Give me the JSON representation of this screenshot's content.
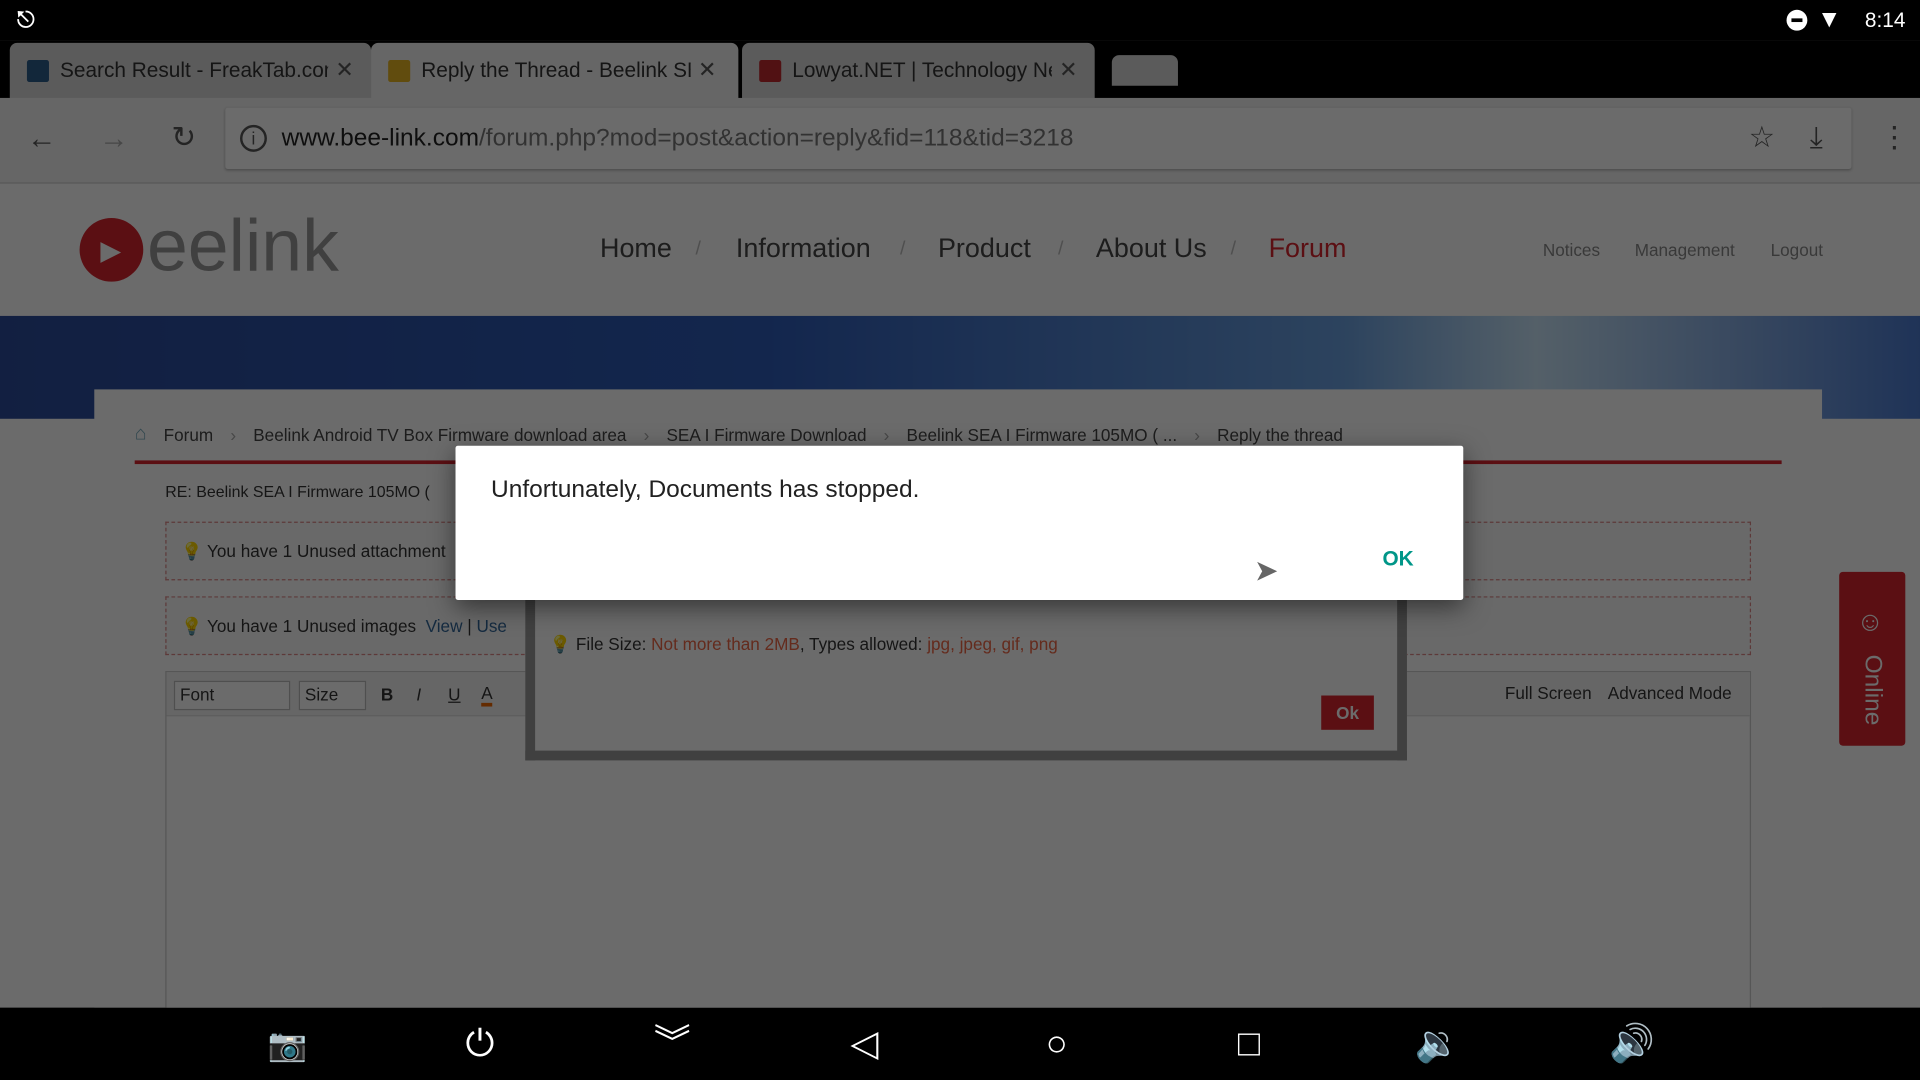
{
  "status_bar": {
    "time": "8:14",
    "left_icon": "link-icon",
    "icons": [
      "do-not-disturb-icon",
      "wifi-icon"
    ]
  },
  "tabs": [
    {
      "title": "Search Result - FreakTab.com",
      "favicon_color": "#2b5c8a"
    },
    {
      "title": "Reply the Thread - Beelink SEA",
      "favicon_color": "#e6b422",
      "active": true
    },
    {
      "title": "Lowyat.NET | Technology News",
      "favicon_color": "#c0282d"
    }
  ],
  "toolbar": {
    "url_host": "www.bee-link.com",
    "url_path": "/forum.php?mod=post&action=reply&fid=118&tid=3218"
  },
  "site": {
    "logo_text": "eelink",
    "nav": [
      "Home",
      "Information",
      "Product",
      "About Us",
      "Forum"
    ],
    "active": "Forum",
    "user_links": [
      "Notices",
      "Management",
      "Logout"
    ],
    "online": "Online"
  },
  "breadcrumb": [
    "Forum",
    "Beelink Android TV Box Firmware download area",
    "SEA I Firmware Download",
    "Beelink SEA I Firmware 105MO ( ...",
    "Reply the thread"
  ],
  "post": {
    "subject": "RE: Beelink SEA I Firmware 105MO (",
    "attach_tip": "You have 1 Unused attachment",
    "images_tip": "You have 1 Unused images",
    "view": "View",
    "use": "Use"
  },
  "editor": {
    "font": "Font",
    "size": "Size",
    "bold": "B",
    "italic": "I",
    "underline": "U",
    "color": "A",
    "full_screen": "Full Screen",
    "advanced": "Advanced Mode"
  },
  "upload_popup": {
    "file_size_label": "File Size:",
    "file_size": "Not more than 2MB",
    "types_label": ", Types allowed:",
    "types": "jpg, jpeg, gif, png",
    "ok": "Ok"
  },
  "dialog": {
    "message": "Unfortunately, Documents has stopped.",
    "ok": "OK",
    "accent": "#009688"
  },
  "nav_bar": [
    "screenshot-icon",
    "power-icon",
    "collapse-icon",
    "back-icon",
    "home-icon",
    "recents-icon",
    "volume-down-icon",
    "volume-up-icon"
  ]
}
